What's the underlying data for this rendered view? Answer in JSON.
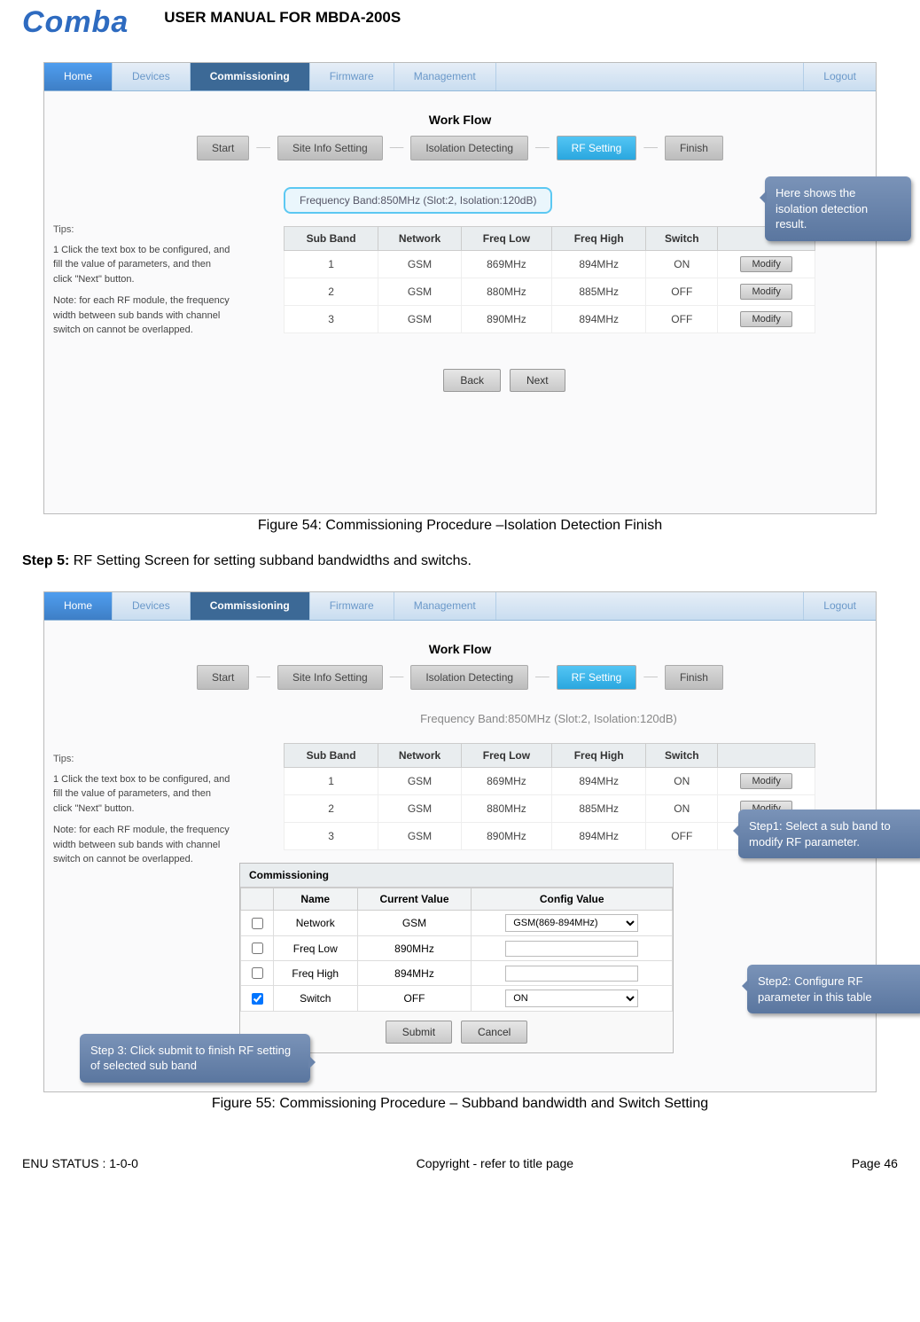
{
  "header": {
    "brand": "Comba",
    "manual_title": "USER MANUAL FOR MBDA-200S"
  },
  "nav": {
    "items": [
      "Home",
      "Devices",
      "Commissioning",
      "Firmware",
      "Management"
    ],
    "logout": "Logout"
  },
  "workflow": {
    "title": "Work Flow",
    "steps": [
      "Start",
      "Site Info Setting",
      "Isolation Detecting",
      "RF Setting",
      "Finish"
    ]
  },
  "tips": {
    "heading": "Tips:",
    "line1": "1 Click the text box to be configured, and fill the value of parameters, and then click \"Next\" button.",
    "line2": "Note: for each RF module, the frequency width between sub bands with channel switch on cannot be overlapped."
  },
  "freq_band": "Frequency Band:850MHz  (Slot:2, Isolation:120dB)",
  "subband": {
    "headers": [
      "Sub Band",
      "Network",
      "Freq Low",
      "Freq High",
      "Switch",
      ""
    ],
    "rows_fig54": [
      [
        "1",
        "GSM",
        "869MHz",
        "894MHz",
        "ON"
      ],
      [
        "2",
        "GSM",
        "880MHz",
        "885MHz",
        "OFF"
      ],
      [
        "3",
        "GSM",
        "890MHz",
        "894MHz",
        "OFF"
      ]
    ],
    "rows_fig55": [
      [
        "1",
        "GSM",
        "869MHz",
        "894MHz",
        "ON"
      ],
      [
        "2",
        "GSM",
        "880MHz",
        "885MHz",
        "ON"
      ],
      [
        "3",
        "GSM",
        "890MHz",
        "894MHz",
        "OFF"
      ]
    ],
    "modify": "Modify"
  },
  "buttons": {
    "back": "Back",
    "next": "Next",
    "submit": "Submit",
    "cancel": "Cancel"
  },
  "callouts": {
    "c1": "Here shows the isolation detection result.",
    "c2": "Step1: Select a sub band to modify RF parameter.",
    "c3": "Step2: Configure RF parameter in this table",
    "c4": "Step 3: Click submit to finish RF setting of selected sub band"
  },
  "commissioning": {
    "title": "Commissioning",
    "headers": [
      "",
      "Name",
      "Current Value",
      "Config Value"
    ],
    "rows": [
      {
        "checked": false,
        "name": "Network",
        "current": "GSM",
        "config": "GSM(869-894MHz)",
        "type": "select"
      },
      {
        "checked": false,
        "name": "Freq Low",
        "current": "890MHz",
        "config": "",
        "type": "text"
      },
      {
        "checked": false,
        "name": "Freq High",
        "current": "894MHz",
        "config": "",
        "type": "text"
      },
      {
        "checked": true,
        "name": "Switch",
        "current": "OFF",
        "config": "ON",
        "type": "select"
      }
    ]
  },
  "captions": {
    "fig54": "Figure 54: Commissioning Procedure –Isolation Detection Finish",
    "fig55": "Figure 55: Commissioning Procedure – Subband bandwidth and Switch Setting"
  },
  "step5": {
    "label": "Step 5:",
    "text": " RF Setting Screen for setting subband bandwidths and switchs."
  },
  "footer": {
    "left": "ENU STATUS : 1-0-0",
    "center": "Copyright - refer to title page",
    "right": "Page 46"
  }
}
